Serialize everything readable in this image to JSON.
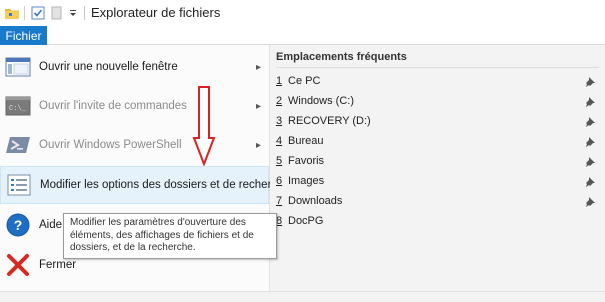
{
  "window": {
    "title": "Explorateur de fichiers"
  },
  "ribbon": {
    "file_tab_label": "Fichier"
  },
  "file_menu": {
    "items": [
      {
        "label": "Ouvrir une nouvelle fenêtre",
        "icon": "new-window-icon",
        "enabled": true,
        "has_submenu": true
      },
      {
        "label": "Ouvrir l'invite de commandes",
        "icon": "command-prompt-icon",
        "enabled": false,
        "has_submenu": true
      },
      {
        "label": "Ouvrir Windows PowerShell",
        "icon": "powershell-icon",
        "enabled": false,
        "has_submenu": true
      },
      {
        "label": "Modifier les options des dossiers et de recherche",
        "icon": "folder-options-icon",
        "enabled": true,
        "has_submenu": false,
        "hovered": true
      },
      {
        "label": "Aide",
        "icon": "help-icon",
        "enabled": true,
        "has_submenu": true
      },
      {
        "label": "Fermer",
        "icon": "close-icon",
        "enabled": true,
        "has_submenu": false
      }
    ]
  },
  "frequent_places": {
    "heading": "Emplacements fréquents",
    "items": [
      {
        "num": "1",
        "name": "Ce PC"
      },
      {
        "num": "2",
        "name": "Windows (C:)"
      },
      {
        "num": "3",
        "name": "RECOVERY (D:)"
      },
      {
        "num": "4",
        "name": "Bureau"
      },
      {
        "num": "5",
        "name": "Favoris"
      },
      {
        "num": "6",
        "name": "Images"
      },
      {
        "num": "7",
        "name": "Downloads"
      },
      {
        "num": "8",
        "name": "DocPG"
      }
    ]
  },
  "tooltip": {
    "line1": "Modifier les paramètres d'ouverture des",
    "line2": "éléments, des affichages de fichiers et de",
    "line3": "dossiers, et de la recherche."
  },
  "colors": {
    "accent": "#1979ca",
    "annotation_arrow": "#e02020",
    "hover_bg": "#e5f1fb"
  }
}
